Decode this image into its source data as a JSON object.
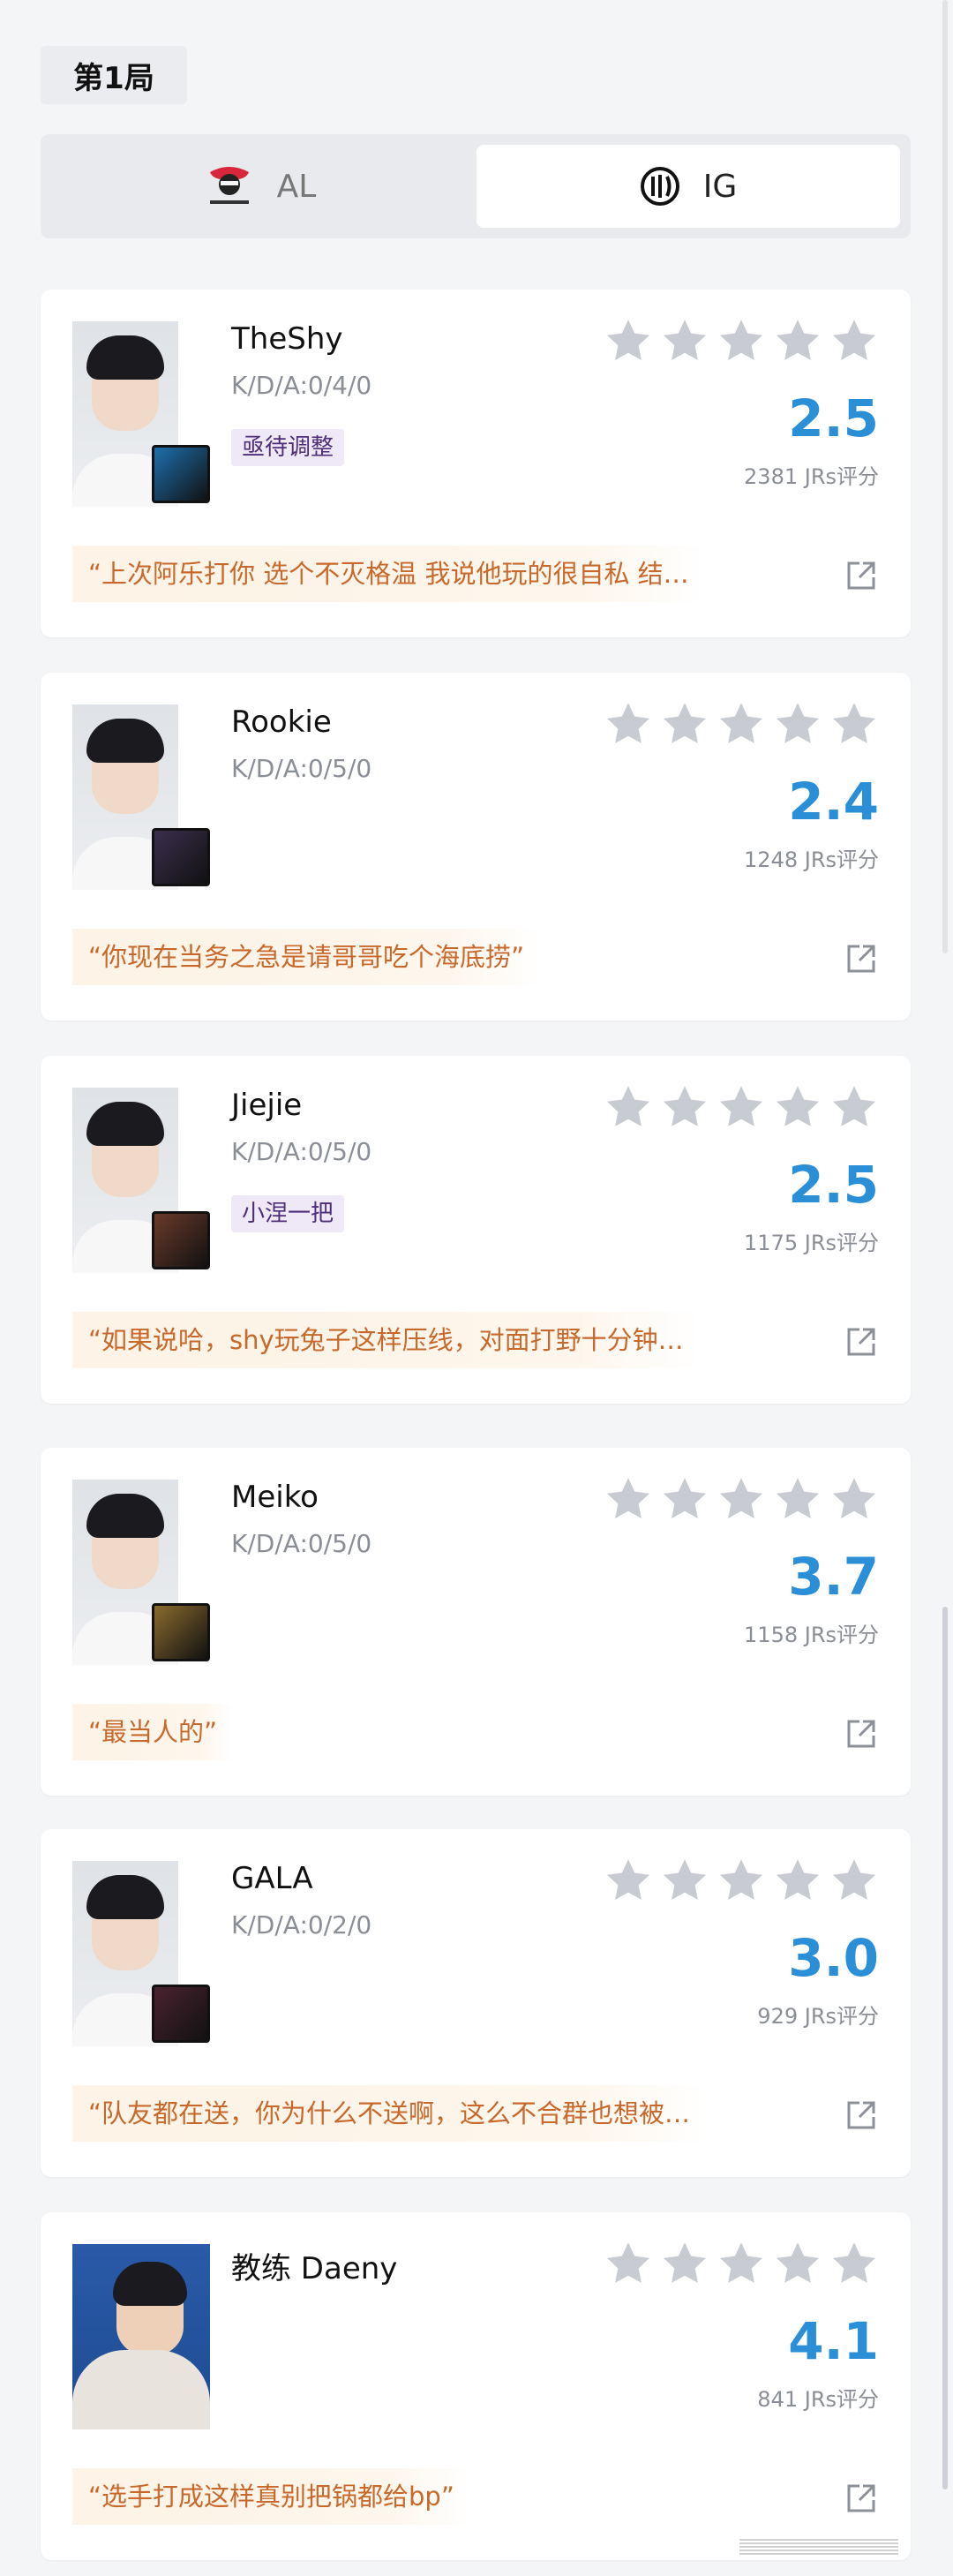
{
  "round": {
    "label": "第1局"
  },
  "teams": [
    {
      "name": "AL",
      "logo": "al-team-logo",
      "selected": false
    },
    {
      "name": "IG",
      "logo": "ig-team-logo",
      "selected": true
    }
  ],
  "players": [
    {
      "name": "TheShy",
      "kda": "K/D/A:0/4/0",
      "tag": "亟待调整",
      "score": "2.5",
      "votes": "2381 JRs评分",
      "comment": "“上次阿乐打你 选个不灭格温 我说他玩的很自私 结…",
      "champion_color": "#1d6fae"
    },
    {
      "name": "Rookie",
      "kda": "K/D/A:0/5/0",
      "tag": "",
      "score": "2.4",
      "votes": "1248 JRs评分",
      "comment": "“你现在当务之急是请哥哥吃个海底捞”",
      "champion_color": "#3b2f4d"
    },
    {
      "name": "Jiejie",
      "kda": "K/D/A:0/5/0",
      "tag": "小涅一把",
      "score": "2.5",
      "votes": "1175 JRs评分",
      "comment": "“如果说哈，shy玩兔子这样压线，对面打野十分钟…",
      "champion_color": "#6b3a2a"
    },
    {
      "name": "Meiko",
      "kda": "K/D/A:0/5/0",
      "tag": "",
      "score": "3.7",
      "votes": "1158 JRs评分",
      "comment": "“最当人的”",
      "champion_color": "#8a6a2e"
    },
    {
      "name": "GALA",
      "kda": "K/D/A:0/2/0",
      "tag": "",
      "score": "3.0",
      "votes": "929 JRs评分",
      "comment": "“队友都在送，你为什么不送啊，这么不合群也想被…",
      "champion_color": "#4a2230"
    },
    {
      "name": "教练 Daeny",
      "kda": "",
      "tag": "",
      "score": "4.1",
      "votes": "841 JRs评分",
      "comment": "“选手打成这样真别把锅都给bp”",
      "champion_color": ""
    }
  ],
  "colors": {
    "score": "#2a8fd6",
    "comment": "#c8692b",
    "tag_bg": "#efe8f6",
    "star": "#c9cbd3"
  },
  "icons": {
    "star": "star-icon",
    "share": "share-icon"
  }
}
